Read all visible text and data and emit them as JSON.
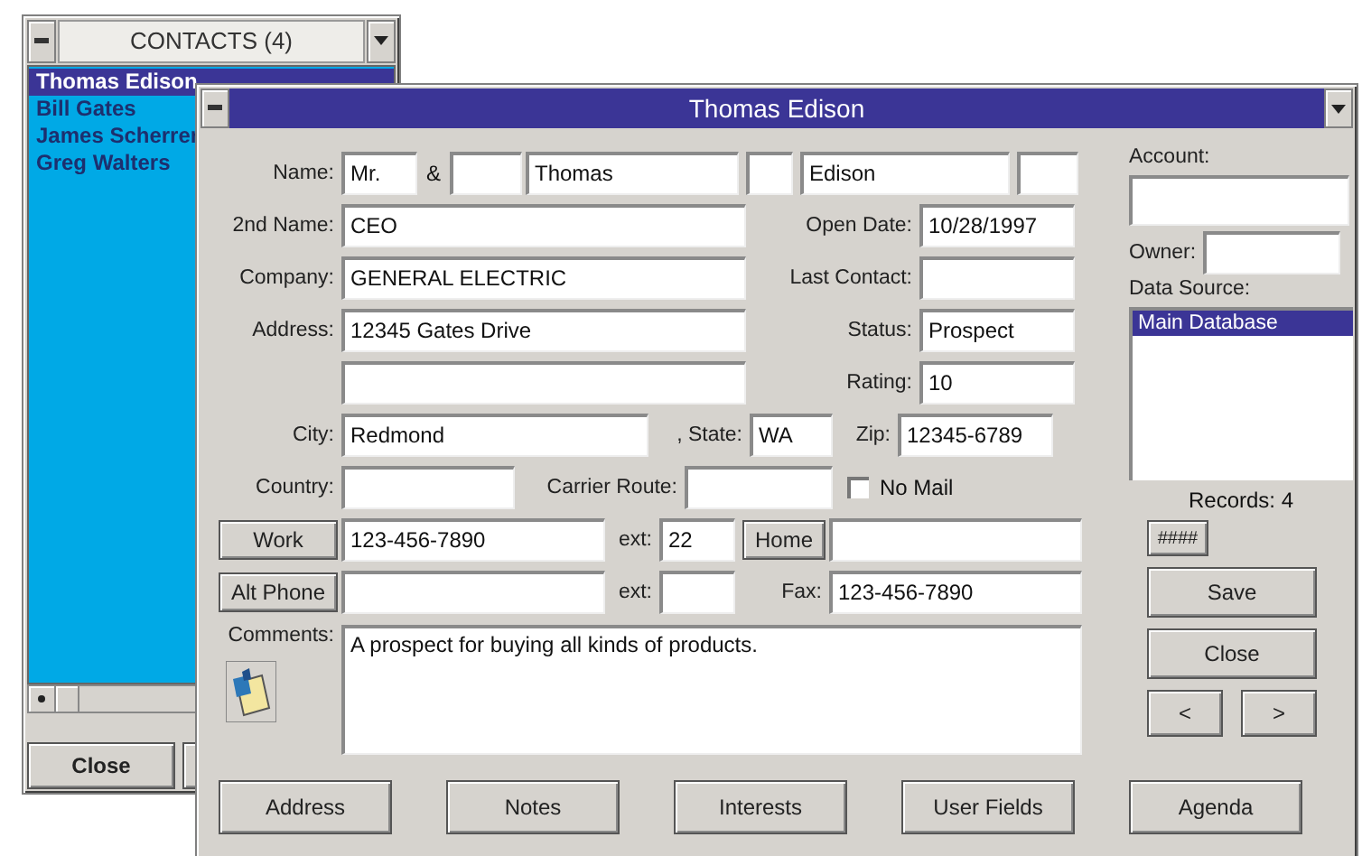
{
  "contacts_window": {
    "title": "CONTACTS (4)",
    "items": [
      {
        "label": "Thomas Edison",
        "selected": true
      },
      {
        "label": "Bill Gates",
        "selected": false
      },
      {
        "label": "James Scherrer",
        "selected": false
      },
      {
        "label": "Greg Walters",
        "selected": false
      }
    ],
    "close_button": "Close"
  },
  "contact_form": {
    "title": "Thomas Edison",
    "name_label": "Name:",
    "salutation": "Mr.",
    "ampersand": "&",
    "first_name": "Thomas",
    "last_name": "Edison",
    "second_name_label": "2nd Name:",
    "second_name": "CEO",
    "company_label": "Company:",
    "company": "GENERAL ELECTRIC",
    "address_label": "Address:",
    "address": "12345 Gates Drive",
    "city_label": "City:",
    "city": "Redmond",
    "state_label": ", State:",
    "state": "WA",
    "zip_label": "Zip:",
    "zip": "12345-6789",
    "country_label": "Country:",
    "carrier_route_label": "Carrier Route:",
    "no_mail": {
      "label": "No Mail",
      "checked": false
    },
    "open_date_label": "Open Date:",
    "open_date": "10/28/1997",
    "last_contact_label": "Last Contact:",
    "status_label": "Status:",
    "status": "Prospect",
    "rating_label": "Rating:",
    "rating": "10",
    "work_button": "Work",
    "work_phone": "123-456-7890",
    "work_ext_label": "ext:",
    "work_ext": "22",
    "home_button": "Home",
    "alt_phone_button": "Alt Phone",
    "alt_ext_label": "ext:",
    "fax_label": "Fax:",
    "fax": "123-456-7890",
    "comments_label": "Comments:",
    "comments": "A prospect for buying all kinds of products.",
    "account_label": "Account:",
    "owner_label": "Owner:",
    "data_source_label": "Data Source:",
    "data_sources": [
      {
        "label": "Main Database",
        "selected": true
      }
    ],
    "records": "Records: 4",
    "record_button": "####",
    "side_buttons": [
      "Save",
      "Close"
    ],
    "nav_buttons": [
      "<",
      ">"
    ],
    "bottom_buttons": [
      "Address",
      "Notes",
      "Interests",
      "User Fields",
      "Agenda"
    ]
  }
}
